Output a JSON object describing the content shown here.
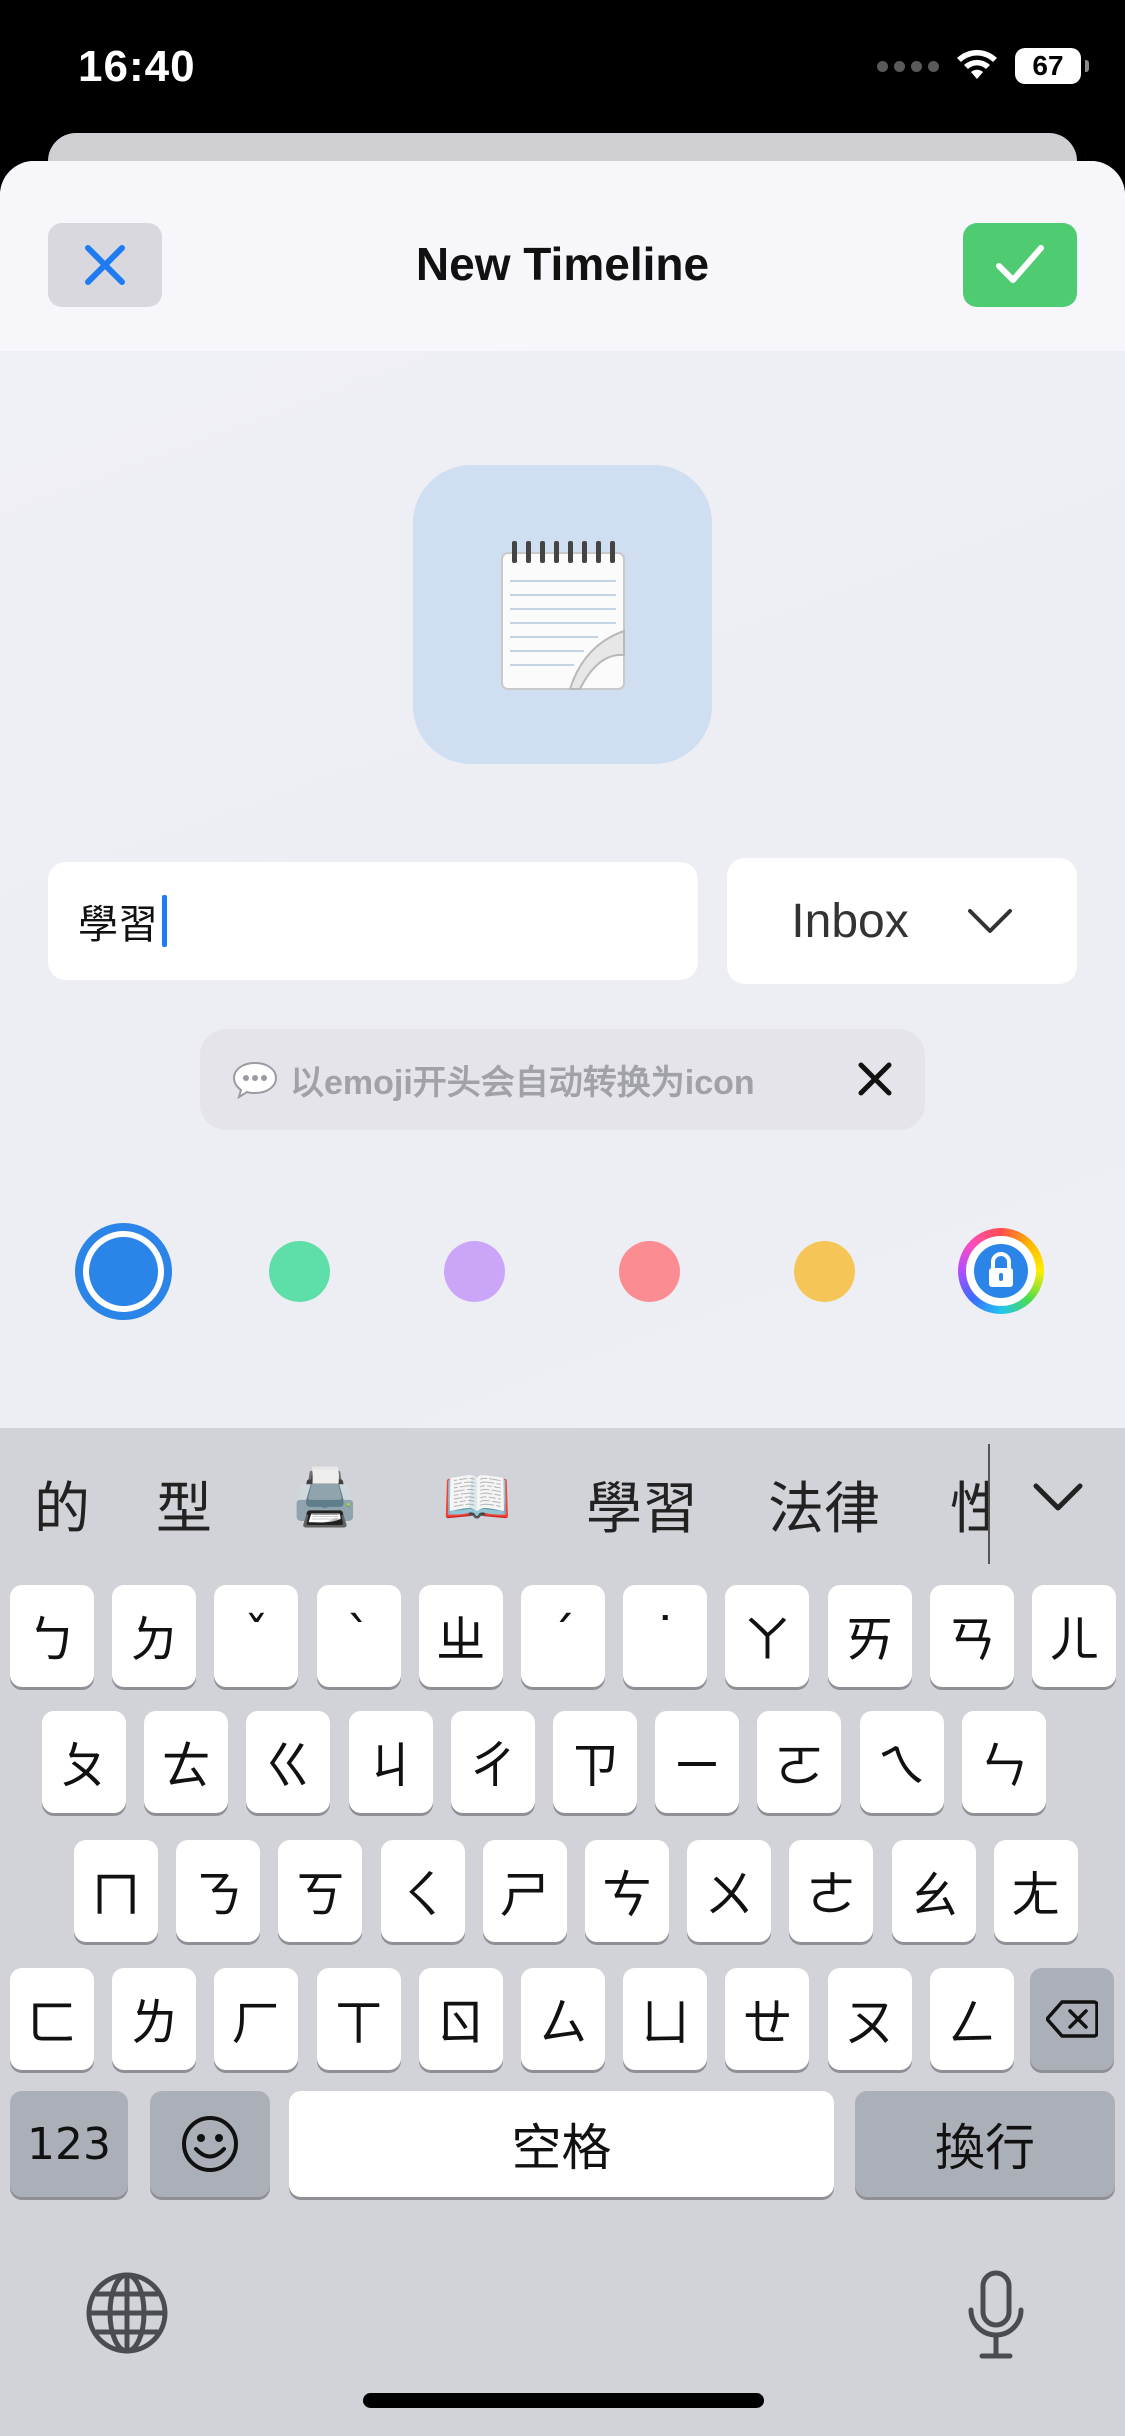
{
  "status_bar": {
    "time": "16:40",
    "battery": "67"
  },
  "sheet": {
    "title": "New Timeline",
    "close_icon": "close-icon",
    "confirm_icon": "checkmark-icon"
  },
  "icon_tile": {
    "emoji": "📝"
  },
  "name_input": {
    "value": "學習"
  },
  "category_select": {
    "value": "Inbox"
  },
  "hint": {
    "bubble_icon": "speech-bubble-icon",
    "text": "以emoji开头会自动转换为icon"
  },
  "colors": {
    "options": [
      {
        "name": "blue",
        "hex": "#2b84e8",
        "selected": true
      },
      {
        "name": "green",
        "hex": "#5edfa9"
      },
      {
        "name": "purple",
        "hex": "#cba6f8"
      },
      {
        "name": "red",
        "hex": "#fb8c92"
      },
      {
        "name": "yellow",
        "hex": "#f6c557"
      },
      {
        "name": "locked-custom",
        "icon": "lock-icon"
      }
    ]
  },
  "keyboard": {
    "candidates": [
      "的",
      "型",
      "🖨️",
      "📖",
      "學習",
      "法律",
      "性"
    ],
    "row1": [
      "ㄅ",
      "ㄉ",
      "ˇ",
      "ˋ",
      "ㄓ",
      "ˊ",
      "˙",
      "ㄚ",
      "ㄞ",
      "ㄢ",
      "ㄦ"
    ],
    "row2": [
      "ㄆ",
      "ㄊ",
      "ㄍ",
      "ㄐ",
      "ㄔ",
      "ㄗ",
      "ㄧ",
      "ㄛ",
      "ㄟ",
      "ㄣ"
    ],
    "row3": [
      "ㄇ",
      "ㄋ",
      "ㄎ",
      "ㄑ",
      "ㄕ",
      "ㄘ",
      "ㄨ",
      "ㄜ",
      "ㄠ",
      "ㄤ"
    ],
    "row4": [
      "ㄈ",
      "ㄌ",
      "ㄏ",
      "ㄒ",
      "ㄖ",
      "ㄙ",
      "ㄩ",
      "ㄝ",
      "ㄡ",
      "ㄥ"
    ],
    "numbers_label": "123",
    "space_label": "空格",
    "return_label": "換行"
  }
}
